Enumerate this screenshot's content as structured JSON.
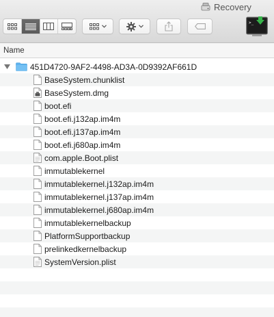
{
  "window": {
    "title": "Recovery",
    "title_icon": "drive-icon"
  },
  "toolbar": {
    "view_buttons": [
      "icon-view",
      "list-view",
      "column-view",
      "gallery-view"
    ],
    "active_view": "list-view",
    "arrange_icon": "arrange-icon",
    "action_icon": "gear-icon",
    "share_icon": "share-icon",
    "tag_icon": "tag-icon",
    "app_icon": "terminal-install-icon"
  },
  "list": {
    "column_header": "Name",
    "folder": {
      "name": "451D4720-9AF2-4498-AD3A-0D9392AF661D",
      "expanded": true
    },
    "items": [
      {
        "name": "BaseSystem.chunklist",
        "icon": "document-icon"
      },
      {
        "name": "BaseSystem.dmg",
        "icon": "disk-image-icon"
      },
      {
        "name": "boot.efi",
        "icon": "document-icon"
      },
      {
        "name": "boot.efi.j132ap.im4m",
        "icon": "document-icon"
      },
      {
        "name": "boot.efi.j137ap.im4m",
        "icon": "document-icon"
      },
      {
        "name": "boot.efi.j680ap.im4m",
        "icon": "document-icon"
      },
      {
        "name": "com.apple.Boot.plist",
        "icon": "plist-document-icon"
      },
      {
        "name": "immutablekernel",
        "icon": "document-icon"
      },
      {
        "name": "immutablekernel.j132ap.im4m",
        "icon": "document-icon"
      },
      {
        "name": "immutablekernel.j137ap.im4m",
        "icon": "document-icon"
      },
      {
        "name": "immutablekernel.j680ap.im4m",
        "icon": "document-icon"
      },
      {
        "name": "immutablekernelbackup",
        "icon": "document-icon"
      },
      {
        "name": "PlatformSupportbackup",
        "icon": "document-icon"
      },
      {
        "name": "prelinkedkernelbackup",
        "icon": "document-icon"
      },
      {
        "name": "SystemVersion.plist",
        "icon": "plist-document-icon"
      }
    ]
  },
  "colors": {
    "folder": "#5fb3ee",
    "selected_view": "#5f5f5f"
  }
}
